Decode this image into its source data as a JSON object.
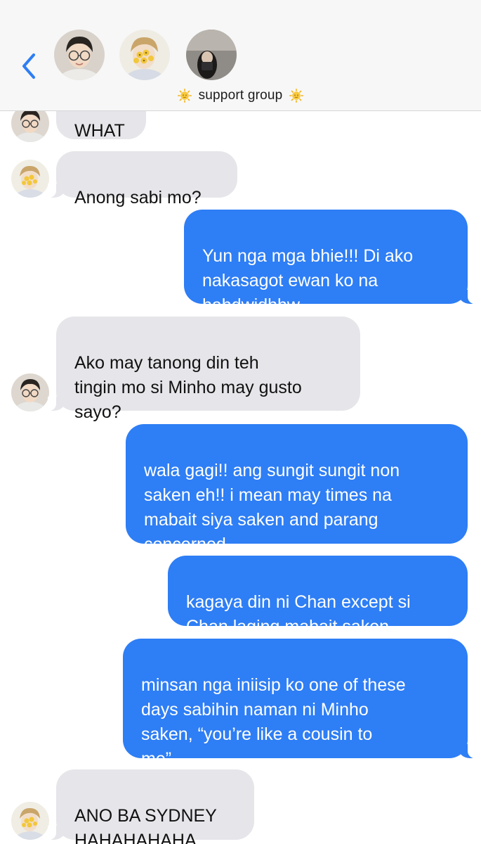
{
  "header": {
    "back_icon": "chevron-left-icon",
    "group_name": "support group",
    "group_emoji_icon": "sun-face-icon",
    "accent_color": "#2e7ef5"
  },
  "messages": [
    {
      "sender": "friend-glasses",
      "direction": "incoming",
      "text": "WHAT"
    },
    {
      "sender": "friend-flower",
      "direction": "incoming",
      "text": "Anong sabi mo?"
    },
    {
      "sender": "me",
      "direction": "outgoing",
      "text": "Yun nga mga bhie!!! Di ako\nnakasagot ewan ko na\nhahdwjdhhw"
    },
    {
      "sender": "friend-glasses",
      "direction": "incoming",
      "text": "Ako may tanong din teh\ntingin mo si Minho may gusto\nsayo?"
    },
    {
      "sender": "me",
      "direction": "outgoing",
      "text": "wala gagi!! ang sungit sungit non\nsaken eh!! i mean may times na\nmabait siya saken and parang\nconcerned"
    },
    {
      "sender": "me",
      "direction": "outgoing",
      "text": "kagaya din ni Chan except si\nChan laging mabait saken"
    },
    {
      "sender": "me",
      "direction": "outgoing",
      "text": "minsan nga iniisip ko one of these\ndays sabihin naman ni Minho\nsaken, “you’re like a cousin to\nme”"
    },
    {
      "sender": "friend-flower",
      "direction": "incoming",
      "text": "ANO BA SYDNEY\nHAHAHAHAHA"
    }
  ]
}
